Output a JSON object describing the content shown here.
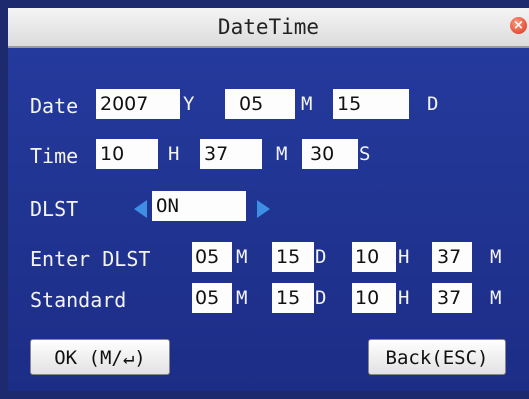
{
  "window": {
    "title": "DateTime",
    "close_glyph": "×"
  },
  "date": {
    "label": "Date",
    "year": "2007",
    "year_unit": "Y",
    "month": "05",
    "month_unit": "M",
    "day": "15",
    "day_unit": "D"
  },
  "time": {
    "label": "Time",
    "hour": "10",
    "hour_unit": "H",
    "minute": "37",
    "minute_unit": "M",
    "second": "30",
    "second_unit": "S"
  },
  "dlst": {
    "label": "DLST",
    "value": "ON"
  },
  "enter_dlst": {
    "label": "Enter DLST",
    "month": "05",
    "month_unit": "M",
    "day": "15",
    "day_unit": "D",
    "hour": "10",
    "hour_unit": "H",
    "minute": "37",
    "minute_unit": "M"
  },
  "standard": {
    "label": "Standard",
    "month": "05",
    "month_unit": "M",
    "day": "15",
    "day_unit": "D",
    "hour": "10",
    "hour_unit": "H",
    "minute": "37",
    "minute_unit": "M"
  },
  "buttons": {
    "ok_label": "OK (M/↵)",
    "back_label": "Back(ESC)"
  },
  "colors": {
    "panel": "#1d2f8e",
    "arrow": "#3f8ee6",
    "titlebar": "#e8e8e8",
    "close": "#d6301a"
  }
}
